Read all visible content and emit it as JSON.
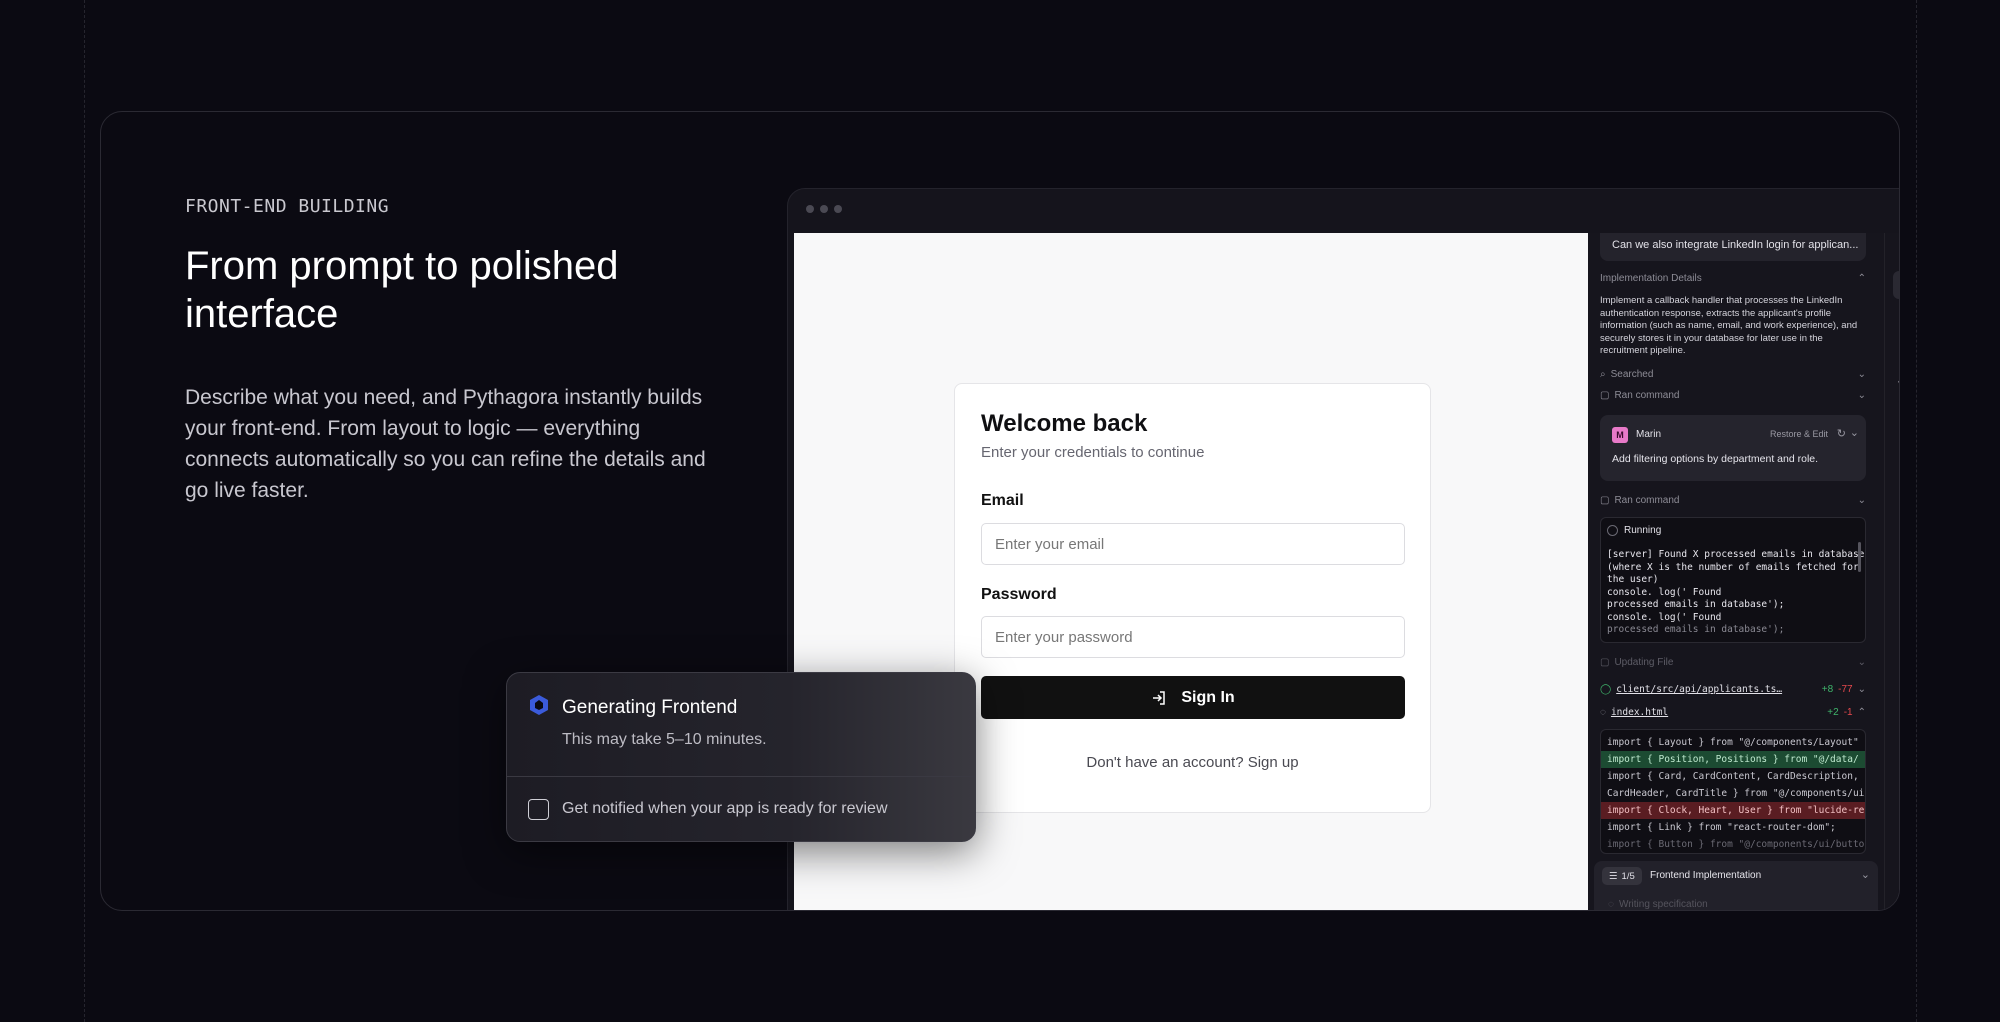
{
  "section": {
    "eyebrow": "FRONT-END BUILDING",
    "headline": "From prompt to polished interface",
    "description": "Describe what you need, and Pythagora instantly builds your front-end. From layout to logic — everything connects automatically so you can refine the details and go live faster."
  },
  "login": {
    "title": "Welcome back",
    "subtitle": "Enter your credentials to continue",
    "email_label": "Email",
    "email_placeholder": "Enter your email",
    "password_label": "Password",
    "password_placeholder": "Enter your password",
    "signin_label": "Sign In",
    "signup_text": "Don't have an account? Sign up"
  },
  "panel": {
    "prompt_chip": "Can we also integrate LinkedIn login for applican...",
    "impl_details_label": "Implementation Details",
    "impl_details_text": "Implement a callback handler that processes the LinkedIn authentication response, extracts the applicant's profile information (such as name, email, and work experience), and securely stores it in your database for later use in the recruitment pipeline.",
    "searched_label": "Searched",
    "ran_command_label": "Ran command",
    "user_initial": "M",
    "user_name": "Marin",
    "restore_edit_label": "Restore & Edit",
    "user_message": "Add filtering options by department and role.",
    "ran_command_label_2": "Ran command",
    "running_label": "Running",
    "terminal_lines": [
      "[server] Found X processed emails in database",
      "(where X is the number of emails fetched for",
      "the user)",
      "console. log(' Found",
      "processed emails in database');",
      "console. log(' Found",
      "processed emails in database');"
    ],
    "updating_file_label": "Updating File",
    "file1_name": "client/src/api/applicants.ts…",
    "file1_added": "+8",
    "file1_removed": "-77",
    "file2_name": "index.html",
    "file2_added": "+2",
    "file2_removed": "-1",
    "code_lines": [
      "import { Layout } from \"@/components/Layout\"",
      "import { Position, Positions } from \"@/data/",
      "import { Card, CardContent, CardDescription, C",
      "CardHeader, CardTitle } from \"@/components/ui/",
      "import { Clock, Heart, User } from \"lucide-rea",
      "import { Link } from \"react-router-dom\";",
      "import { Button } from \"@/components/ui/button"
    ],
    "task_counter": "1/5",
    "task_title": "Frontend Implementation",
    "task_status": "Writing specification"
  },
  "toast": {
    "title": "Generating Frontend",
    "subtitle": "This may take 5–10 minutes.",
    "notify_label": "Get notified when your app is ready for review"
  },
  "colors": {
    "background": "#0b0a12",
    "accent_blue": "#3b5bdb",
    "diff_add": "#1c4b32",
    "diff_remove": "#5a1d22"
  }
}
